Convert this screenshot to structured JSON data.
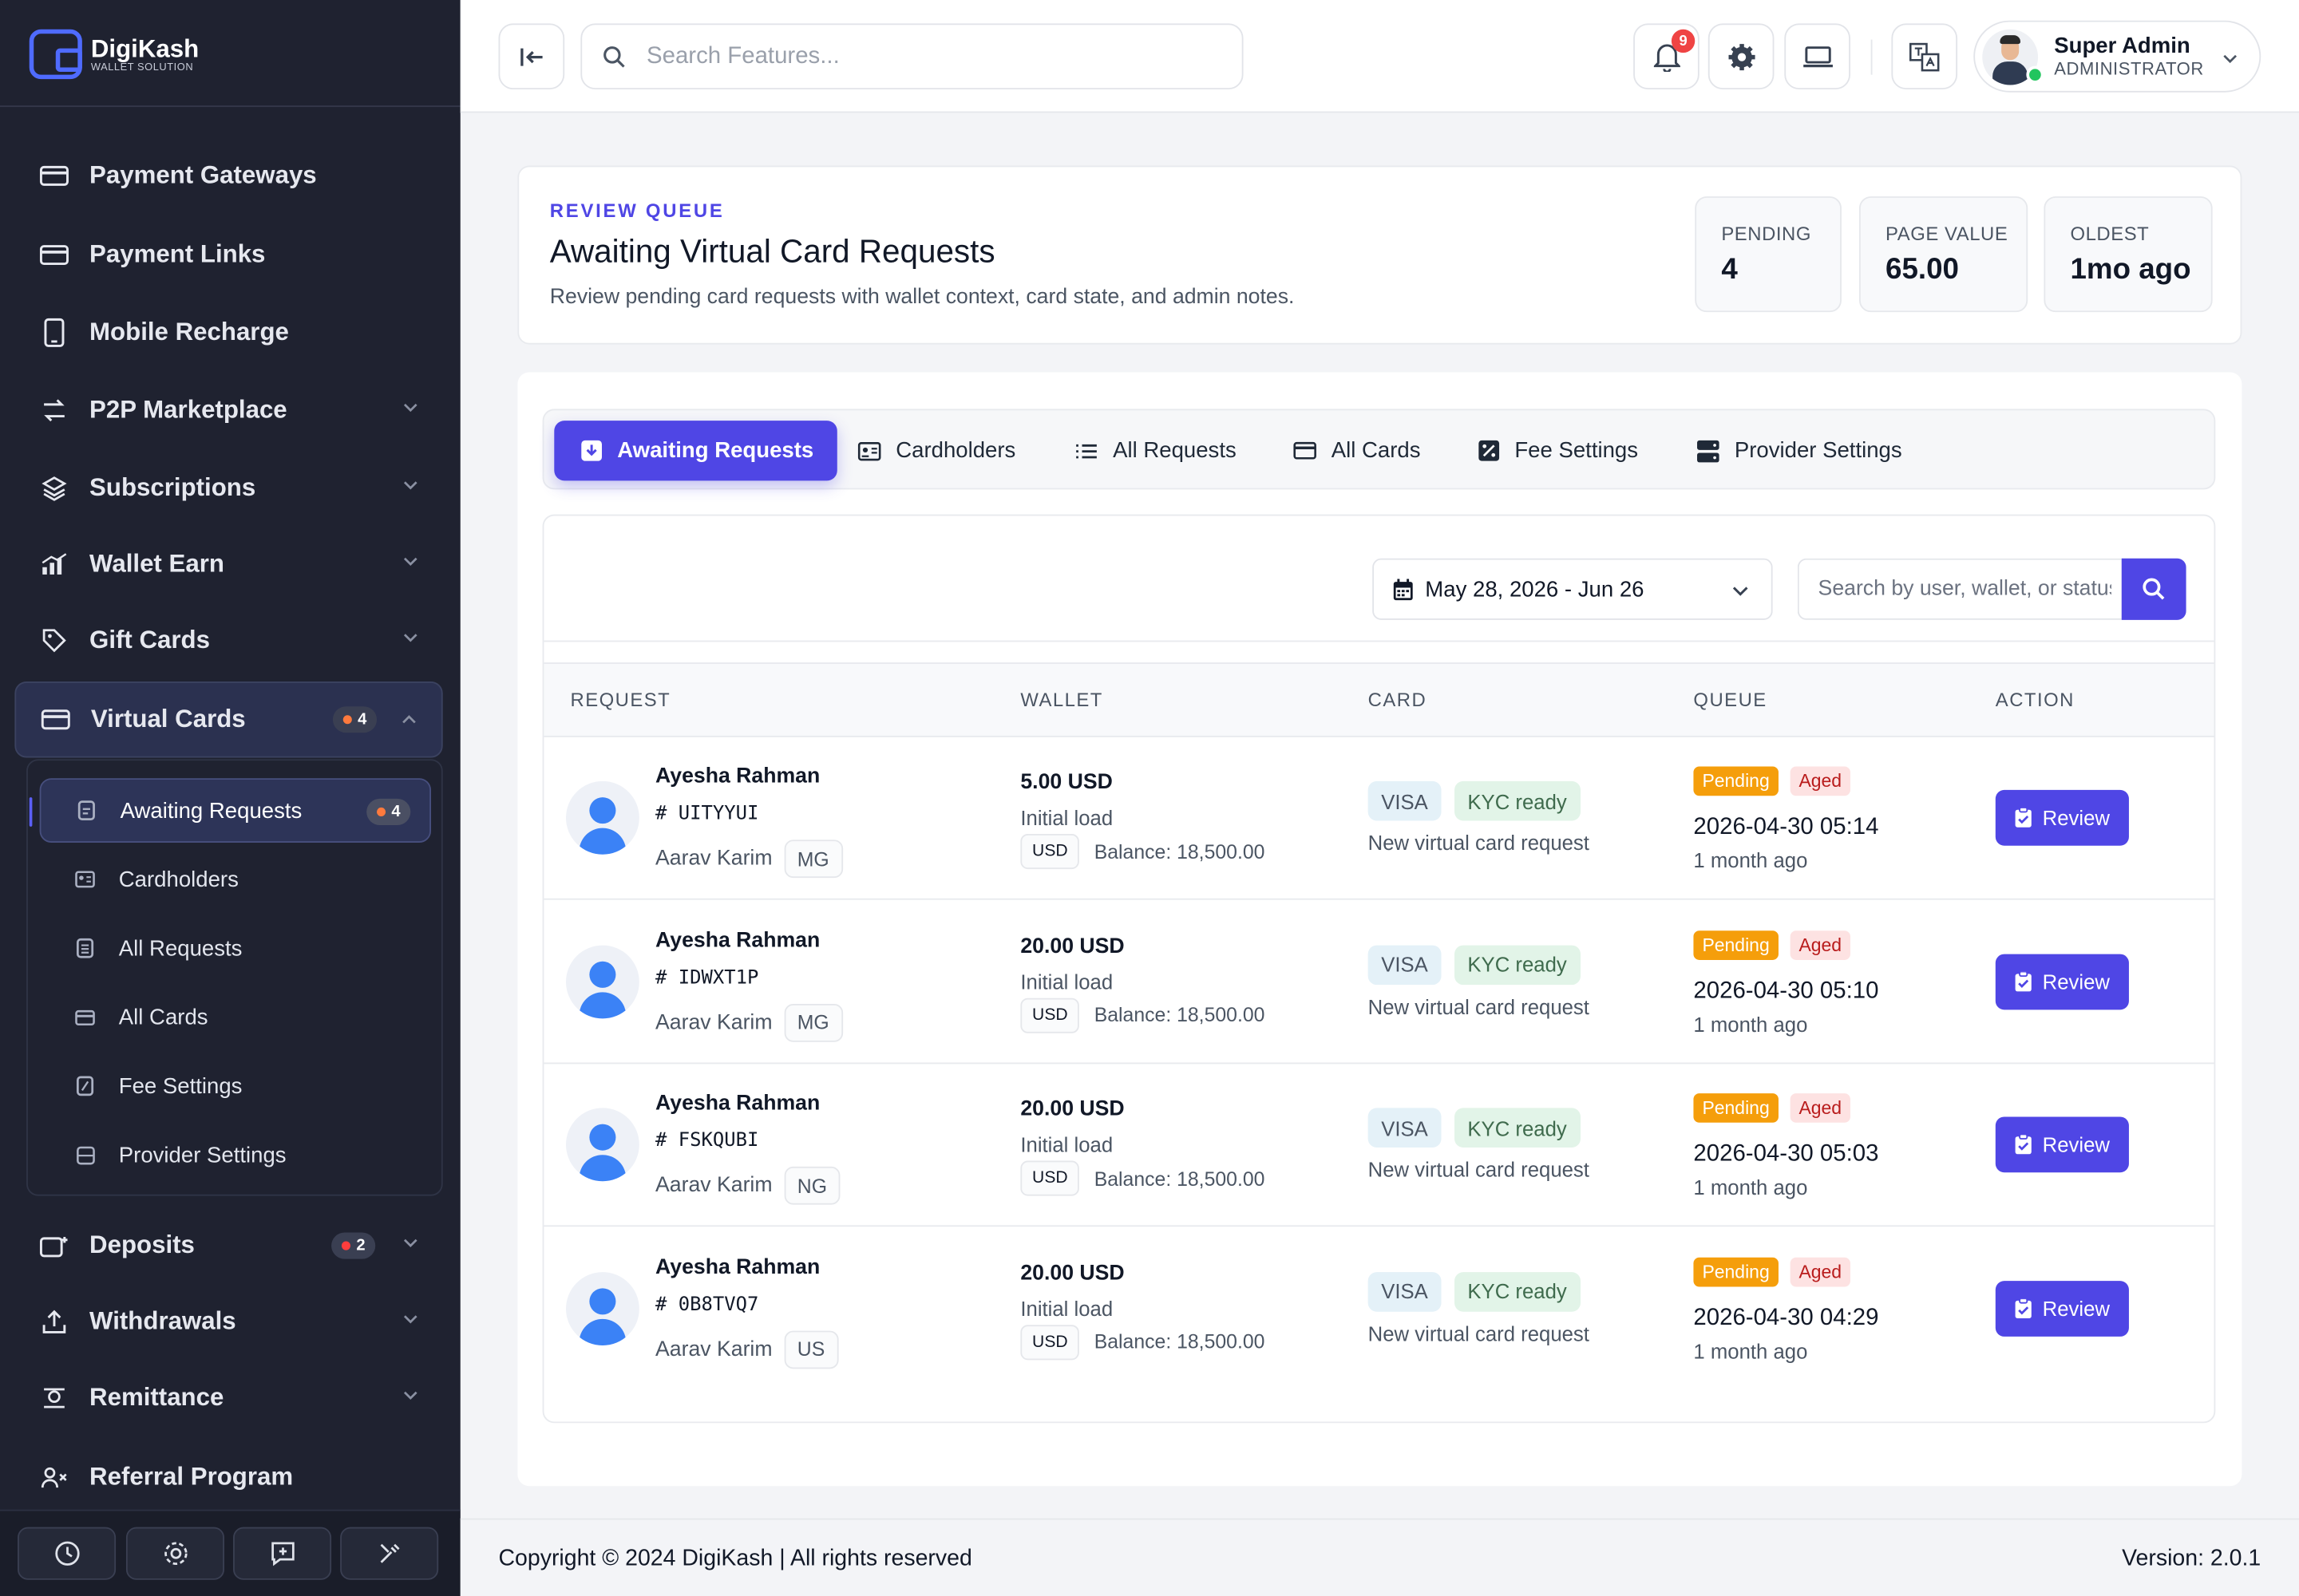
{
  "brand": {
    "name": "DigiKash",
    "tagline": "WALLET SOLUTION"
  },
  "sidebar": {
    "items": [
      {
        "label": "Payment Gateways",
        "icon": "card-icon"
      },
      {
        "label": "Payment Links",
        "icon": "card-icon"
      },
      {
        "label": "Mobile Recharge",
        "icon": "phone-icon"
      },
      {
        "label": "P2P Marketplace",
        "icon": "swap-icon"
      },
      {
        "label": "Subscriptions",
        "icon": "layers-icon"
      },
      {
        "label": "Wallet Earn",
        "icon": "chart-icon"
      },
      {
        "label": "Gift Cards",
        "icon": "tag-icon"
      },
      {
        "label": "Virtual Cards",
        "icon": "card-icon",
        "badge": "4"
      },
      {
        "label": "Deposits",
        "icon": "deposit-icon",
        "badge": "2"
      },
      {
        "label": "Withdrawals",
        "icon": "upload-icon"
      },
      {
        "label": "Remittance",
        "icon": "remit-icon"
      },
      {
        "label": "Referral Program",
        "icon": "referral-icon"
      }
    ],
    "sub_items": [
      {
        "label": "Awaiting Requests",
        "badge": "4"
      },
      {
        "label": "Cardholders"
      },
      {
        "label": "All Requests"
      },
      {
        "label": "All Cards"
      },
      {
        "label": "Fee Settings"
      },
      {
        "label": "Provider Settings"
      }
    ]
  },
  "header": {
    "search_placeholder": "Search Features...",
    "notifications": "9",
    "user_name": "Super Admin",
    "user_role": "ADMINISTRATOR"
  },
  "page": {
    "eyebrow": "REVIEW QUEUE",
    "title": "Awaiting Virtual Card Requests",
    "description": "Review pending card requests with wallet context, card state, and admin notes.",
    "stats": [
      {
        "label": "PENDING",
        "value": "4"
      },
      {
        "label": "PAGE VALUE",
        "value": "65.00"
      },
      {
        "label": "OLDEST",
        "value": "1mo ago"
      }
    ]
  },
  "tabs": [
    "Awaiting Requests",
    "Cardholders",
    "All Requests",
    "All Cards",
    "Fee Settings",
    "Provider Settings"
  ],
  "filter": {
    "date_range": "May 28, 2026 - Jun 26",
    "search_placeholder": "Search by user, wallet, or status"
  },
  "table": {
    "columns": [
      "REQUEST",
      "WALLET",
      "CARD",
      "QUEUE",
      "ACTION"
    ],
    "rows": [
      {
        "name": "Ayesha Rahman",
        "id": "# UITYYUI",
        "holder": "Aarav Karim",
        "country": "MG",
        "amount": "5.00 USD",
        "load": "Initial load",
        "currency": "USD",
        "balance": "Balance: 18,500.00",
        "brand": "VISA",
        "kyc": "KYC ready",
        "card_desc": "New virtual card request",
        "status": "Pending",
        "age_tag": "Aged",
        "date": "2026-04-30 05:14",
        "ago": "1 month ago",
        "action": "Review"
      },
      {
        "name": "Ayesha Rahman",
        "id": "# IDWXT1P",
        "holder": "Aarav Karim",
        "country": "MG",
        "amount": "20.00 USD",
        "load": "Initial load",
        "currency": "USD",
        "balance": "Balance: 18,500.00",
        "brand": "VISA",
        "kyc": "KYC ready",
        "card_desc": "New virtual card request",
        "status": "Pending",
        "age_tag": "Aged",
        "date": "2026-04-30 05:10",
        "ago": "1 month ago",
        "action": "Review"
      },
      {
        "name": "Ayesha Rahman",
        "id": "# FSKQUBI",
        "holder": "Aarav Karim",
        "country": "NG",
        "amount": "20.00 USD",
        "load": "Initial load",
        "currency": "USD",
        "balance": "Balance: 18,500.00",
        "brand": "VISA",
        "kyc": "KYC ready",
        "card_desc": "New virtual card request",
        "status": "Pending",
        "age_tag": "Aged",
        "date": "2026-04-30 05:03",
        "ago": "1 month ago",
        "action": "Review"
      },
      {
        "name": "Ayesha Rahman",
        "id": "# 0B8TVQ7",
        "holder": "Aarav Karim",
        "country": "US",
        "amount": "20.00 USD",
        "load": "Initial load",
        "currency": "USD",
        "balance": "Balance: 18,500.00",
        "brand": "VISA",
        "kyc": "KYC ready",
        "card_desc": "New virtual card request",
        "status": "Pending",
        "age_tag": "Aged",
        "date": "2026-04-30 04:29",
        "ago": "1 month ago",
        "action": "Review"
      }
    ]
  },
  "footer": {
    "copyright": "Copyright © 2024 DigiKash | All rights reserved",
    "version": "Version: 2.0.1"
  },
  "colors": {
    "accent": "#4f46e5",
    "sidebar": "#1f2230",
    "pending": "#f59e0b",
    "aged": "#b91c1c"
  }
}
